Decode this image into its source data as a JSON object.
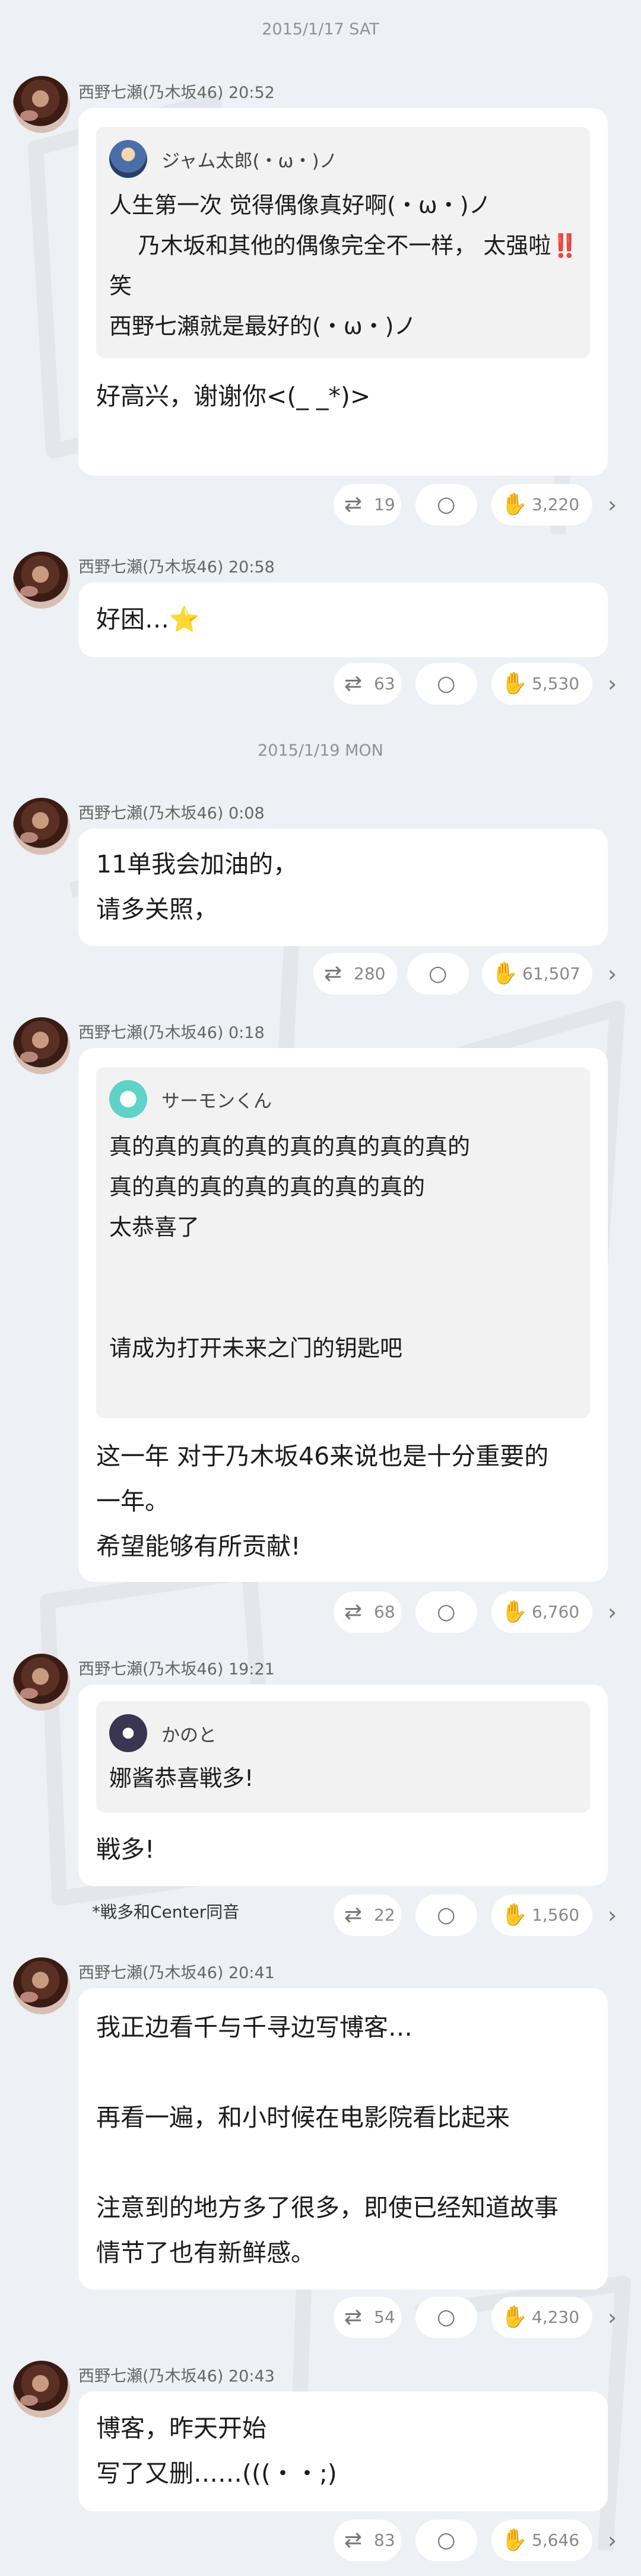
{
  "colors": {
    "background": "#edf0f4",
    "bubble": "#ffffff",
    "quote": "#f2f2f2",
    "muted": "#8d939b"
  },
  "icons": {
    "retweet": "retweet-icon",
    "comment": "comment-icon",
    "clap": "clap-icon",
    "chevron": "chevron-right-icon"
  },
  "dates": [
    "2015/1/17 SAT",
    "2015/1/19 MON"
  ],
  "messages": [
    {
      "sender": "西野七瀬(乃木坂46) 20:52",
      "quote": {
        "name": "ジャム太郎(・ω・)ノ",
        "text": "人生第一次 觉得偶像真好啊(・ω・)ノ\n    乃木坂和其他的偶像完全不一样， 太强啦‼️\n笑\n西野七瀬就是最好的(・ω・)ノ"
      },
      "text": "好高兴，谢谢你<(_ _*)>",
      "retweets": "19",
      "claps": "3,220"
    },
    {
      "sender": "西野七瀬(乃木坂46) 20:58",
      "text": "好困…⭐",
      "retweets": "63",
      "claps": "5,530"
    },
    {
      "sender": "西野七瀬(乃木坂46) 0:08",
      "text": "11单我会加油的，\n请多关照，",
      "retweets": "280",
      "claps": "61,507"
    },
    {
      "sender": "西野七瀬(乃木坂46) 0:18",
      "quote": {
        "name": "サーモンくん",
        "text": "真的真的真的真的真的真的真的真的\n真的真的真的真的真的真的真的\n太恭喜了\n\n\n请成为打开未来之门的钥匙吧"
      },
      "text": "这一年 对于乃木坂46来说也是十分重要的\n一年。\n希望能够有所贡献!",
      "retweets": "68",
      "claps": "6,760"
    },
    {
      "sender": "西野七瀬(乃木坂46) 19:21",
      "quote": {
        "name": "かのと",
        "text": "娜酱恭喜戦多!"
      },
      "text": "戦多!",
      "note": "*戦多和Center同音",
      "retweets": "22",
      "claps": "1,560"
    },
    {
      "sender": "西野七瀬(乃木坂46) 20:41",
      "text": "我正边看千与千寻边写博客…\n\n再看一遍，和小时候在电影院看比起来\n\n注意到的地方多了很多，即使已经知道故事\n情节了也有新鲜感。",
      "retweets": "54",
      "claps": "4,230"
    },
    {
      "sender": "西野七瀬(乃木坂46) 20:43",
      "text": "博客，昨天开始\n写了又删……(((・・;)",
      "retweets": "83",
      "claps": "5,646"
    }
  ]
}
